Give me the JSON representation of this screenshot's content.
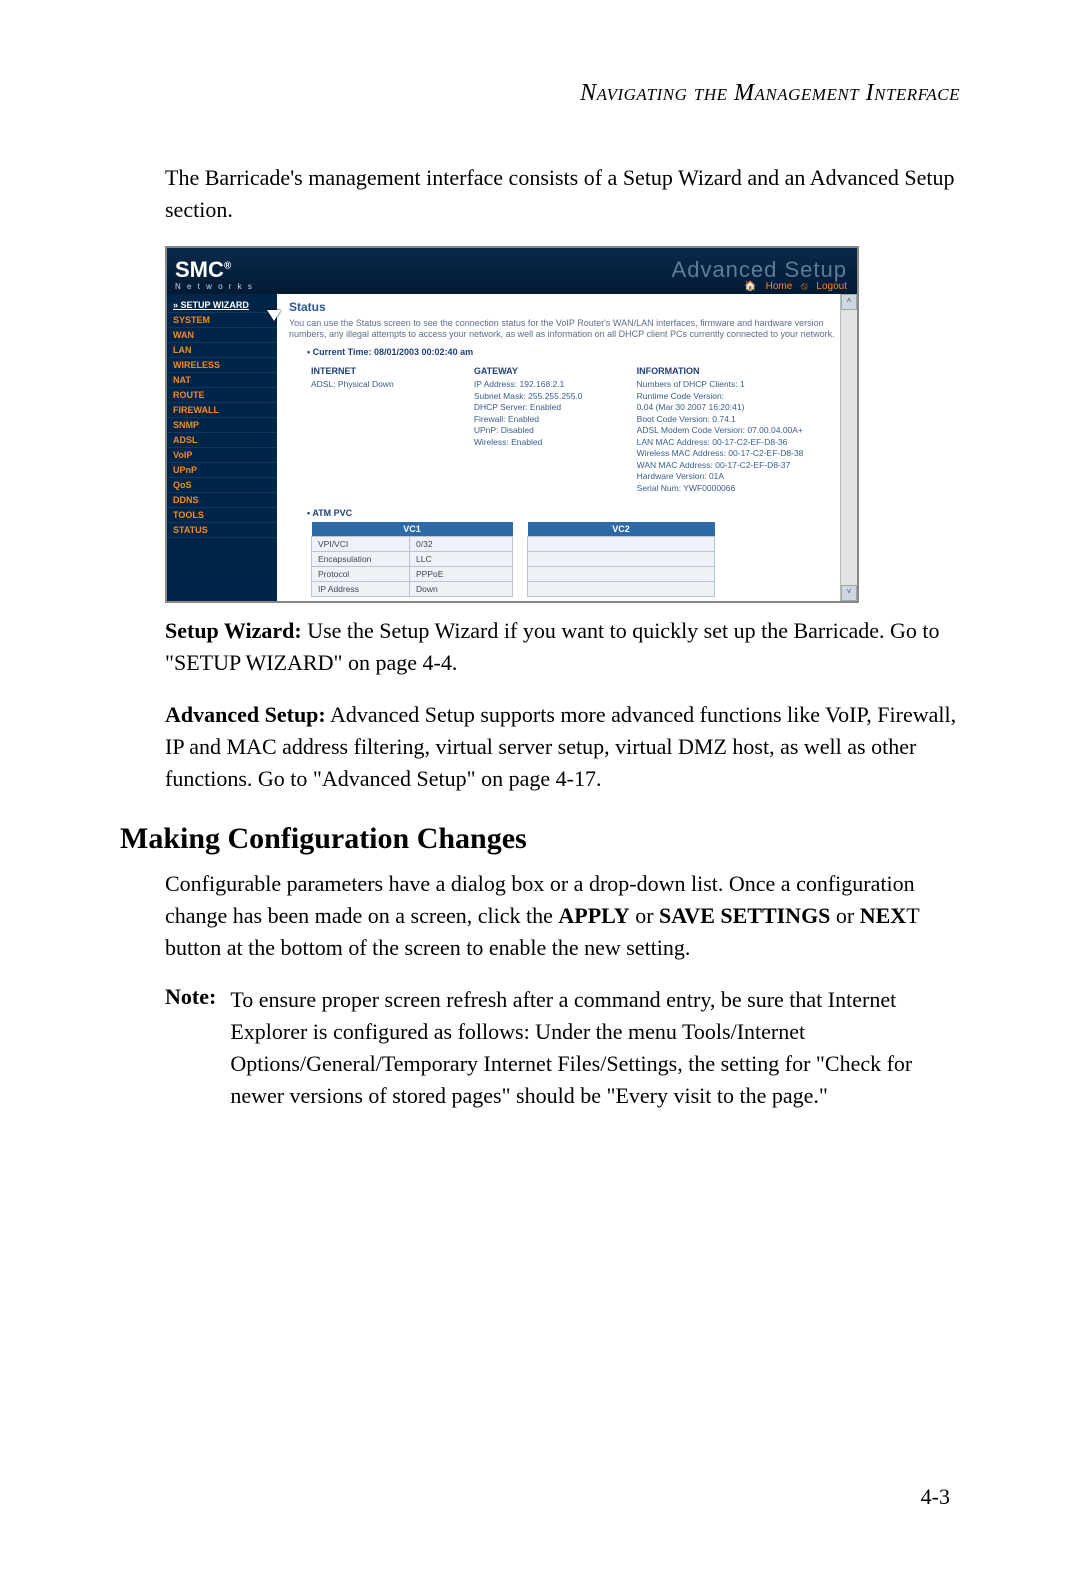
{
  "running_head": "Navigating the Management Interface",
  "intro": "The Barricade's management interface consists of a Setup Wizard and an Advanced Setup section.",
  "screenshot": {
    "logo": "SMC",
    "logo_reg": "®",
    "logo_sub": "N e t w o r k s",
    "adv_title": "Advanced Setup",
    "home_link": "Home",
    "logout_link": "Logout",
    "sidebar": {
      "wizard": "» SETUP WIZARD",
      "items": [
        "SYSTEM",
        "WAN",
        "LAN",
        "WIRELESS",
        "NAT",
        "ROUTE",
        "FIREWALL",
        "SNMP",
        "ADSL",
        "VoIP",
        "UPnP",
        "QoS",
        "DDNS",
        "TOOLS",
        "STATUS"
      ]
    },
    "content": {
      "heading": "Status",
      "desc": "You can use the Status screen to see the connection status for the VoIP Router's WAN/LAN interfaces, firmware and hardware version numbers, any illegal attempts to access your network, as well as information on all DHCP client PCs currently connected to your network.",
      "current_time": "Current Time: 08/01/2003 00:02:40 am",
      "col1_head": "INTERNET",
      "col1_lines": [
        "ADSL:   Physical Down"
      ],
      "col2_head": "GATEWAY",
      "col2_lines": [
        "IP Address: 192.168.2.1",
        "Subnet Mask: 255.255.255.0",
        "DHCP Server: Enabled",
        "Firewall: Enabled",
        "UPnP: Disabled",
        "Wireless: Enabled"
      ],
      "col3_head": "INFORMATION",
      "col3_lines": [
        "Numbers of DHCP Clients:  1",
        "Runtime Code Version:",
        "  0.04 (Mar 30 2007 16:20:41)",
        "Boot Code Version:  0.74.1",
        "ADSL Modem Code Version:  07.00.04.00A+",
        "LAN MAC Address: 00-17-C2-EF-D8-36",
        "Wireless MAC Address: 00-17-C2-EF-D8-38",
        "WAN MAC Address: 00-17-C2-EF-D8-37",
        "Hardware Version:  01A",
        "Serial Num:   YWF0000066"
      ],
      "atm_label": "ATM PVC",
      "vc1": "VC1",
      "vc2": "VC2",
      "rows": [
        {
          "label": "VPI/VCI",
          "val": "0/32"
        },
        {
          "label": "Encapsulation",
          "val": "LLC"
        },
        {
          "label": "Protocol",
          "val": "PPPoE"
        },
        {
          "label": "IP Address",
          "val": "Down"
        }
      ]
    }
  },
  "setup_wizard_label": "Setup Wizard:",
  "setup_wizard_text": " Use the Setup Wizard if you want to quickly set up the Barricade. Go to \"SETUP WIZARD\" on  page 4-4.",
  "adv_setup_label": "Advanced Setup:",
  "adv_setup_text": " Advanced Setup supports more advanced functions like VoIP, Firewall, IP and MAC address filtering, virtual server setup, virtual DMZ host, as well as other functions. Go to \"Advanced Setup\" on page 4-17.",
  "section_heading": "Making Configuration Changes",
  "config_para_pre": "Configurable parameters have a dialog box or a drop-down list. Once a configuration change has been made on a screen, click the ",
  "config_apply": "APPLY",
  "config_or1": " or ",
  "config_save": "SAVE SETTINGS",
  "config_or2": " or ",
  "config_next": "NEX",
  "config_para_post": "T button at the bottom of the screen to enable the new setting.",
  "note_label": "Note:",
  "note_body": "To ensure proper screen refresh after a command entry, be sure that Internet Explorer is configured as follows: Under the menu Tools/Internet Options/General/Temporary Internet Files/Settings, the setting for \"Check for newer versions of stored pages\" should be \"Every visit to the page.\"",
  "page_number": "4-3"
}
